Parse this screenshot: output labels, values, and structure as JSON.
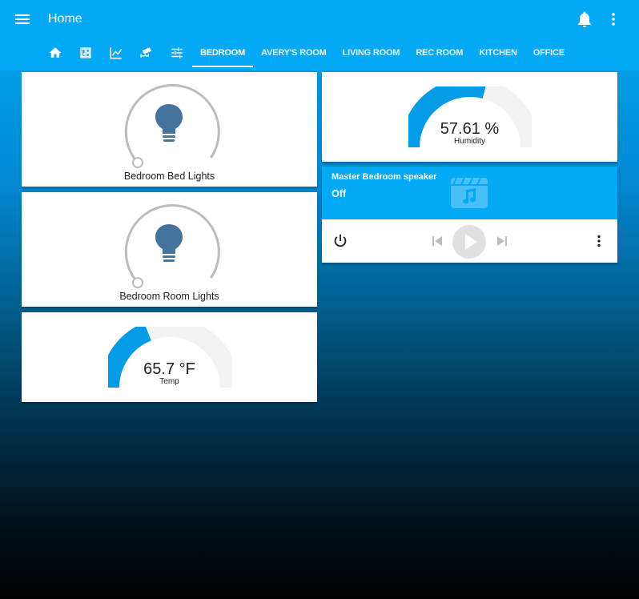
{
  "header": {
    "title": "Home"
  },
  "tabs": {
    "icons": [
      "home-icon",
      "floorplan-icon",
      "chart-line-icon",
      "cctv-icon",
      "sliders-icon"
    ],
    "labels": [
      "BEDROOM",
      "AVERY'S ROOM",
      "LIVING ROOM",
      "REC ROOM",
      "KITCHEN",
      "OFFICE"
    ],
    "active": "BEDROOM"
  },
  "lights": [
    {
      "name": "Bedroom Bed Lights",
      "icon": "lightbulb-icon"
    },
    {
      "name": "Bedroom Room Lights",
      "icon": "lightbulb-icon"
    }
  ],
  "temp_gauge": {
    "value": "65.7 °F",
    "name": "Temp",
    "fill_fraction": 0.38
  },
  "humidity_gauge": {
    "value": "57.61 %",
    "name": "Humidity",
    "fill_fraction": 0.58
  },
  "media_player": {
    "name": "Master Bedroom speaker",
    "state": "Off",
    "icon": "music-video-icon"
  },
  "colors": {
    "accent": "#03a9f4",
    "bulb": "#44739e",
    "gauge_track": "#f2f2f2",
    "slider_track": "#bdbdbd"
  }
}
